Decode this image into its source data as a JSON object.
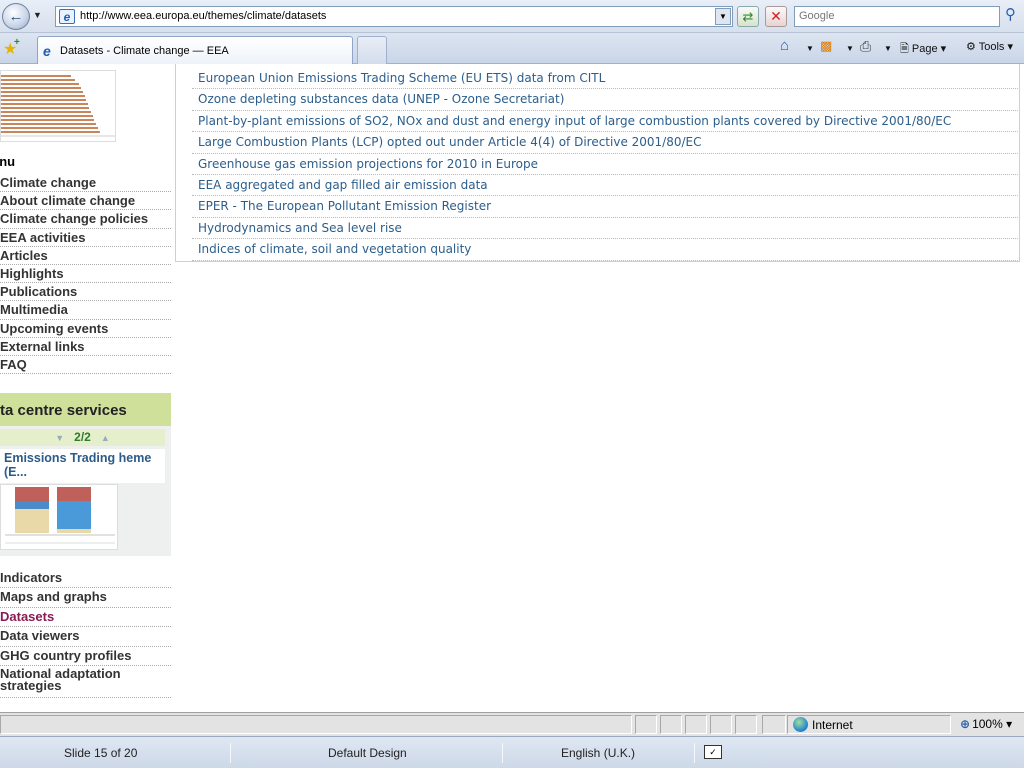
{
  "browser": {
    "url": "http://www.eea.europa.eu/themes/climate/datasets",
    "search_placeholder": "Google",
    "tab_title": "Datasets - Climate change — EEA",
    "commands": {
      "page": "Page",
      "tools": "Tools"
    }
  },
  "sidebar": {
    "menu_title": "enu",
    "menu_items": [
      "Climate change",
      "About climate change",
      "Climate change policies",
      "EEA activities",
      "Articles",
      "Highlights",
      "Publications",
      "Multimedia",
      "Upcoming events",
      "External links",
      "FAQ"
    ],
    "data_centre": {
      "title": "ta centre services",
      "pager": "2/2",
      "item_title": "Emissions Trading heme (E..."
    },
    "links": [
      "Indicators",
      "Maps and graphs",
      "Datasets",
      "Data viewers",
      "GHG country profiles",
      "National adaptation strategies"
    ],
    "current_link": "Datasets"
  },
  "datasets": [
    "European Union Emissions Trading Scheme (EU ETS) data from CITL",
    "Ozone depleting substances data (UNEP - Ozone Secretariat)",
    "Plant-by-plant emissions of SO2, NOx and dust and energy input of large combustion plants covered by Directive 2001/80/EC",
    "Large Combustion Plants (LCP) opted out under Article 4(4) of Directive 2001/80/EC",
    "Greenhouse gas emission projections for 2010 in Europe",
    "EEA aggregated and gap filled air emission data",
    "EPER - The European Pollutant Emission Register",
    "Hydrodynamics and Sea level rise",
    "Indices of climate, soil and vegetation quality"
  ],
  "status": {
    "zone": "Internet",
    "zoom": "100%"
  },
  "powerpoint": {
    "slide": "Slide 15 of 20",
    "design": "Default Design",
    "language": "English (U.K.)"
  },
  "colors": {
    "link": "#2c5e8c",
    "current_link": "#8b1a54",
    "data_centre_header": "#cfe09b"
  }
}
